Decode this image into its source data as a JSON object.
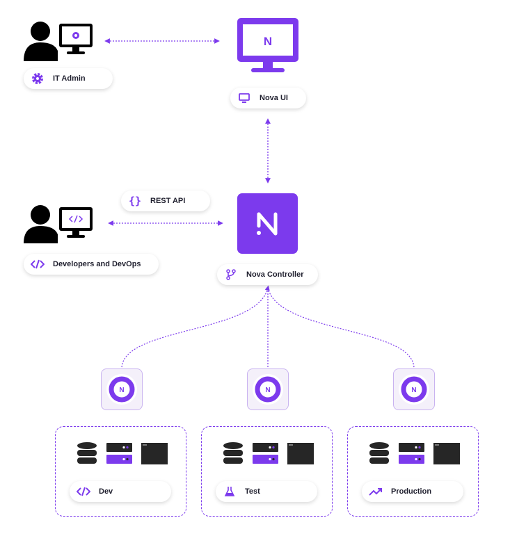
{
  "colors": {
    "accent": "#7c3aed",
    "dark": "#000000",
    "panel": "#262626"
  },
  "actors": {
    "it_admin": {
      "label": "IT Admin",
      "icon": "gear-icon"
    },
    "developers": {
      "label": "Developers and DevOps",
      "icon": "code-icon"
    }
  },
  "nova_ui": {
    "label": "Nova UI",
    "icon": "monitor-icon",
    "logo": "N"
  },
  "rest_api": {
    "label": "REST API",
    "icon": "braces-icon"
  },
  "controller": {
    "label": "Nova Controller",
    "icon": "git-branch-icon",
    "logo": "N"
  },
  "environments": [
    {
      "label": "Dev",
      "icon": "code-icon",
      "agent_logo": "N"
    },
    {
      "label": "Test",
      "icon": "flask-icon",
      "agent_logo": "N"
    },
    {
      "label": "Production",
      "icon": "trending-up-icon",
      "agent_logo": "N"
    }
  ]
}
